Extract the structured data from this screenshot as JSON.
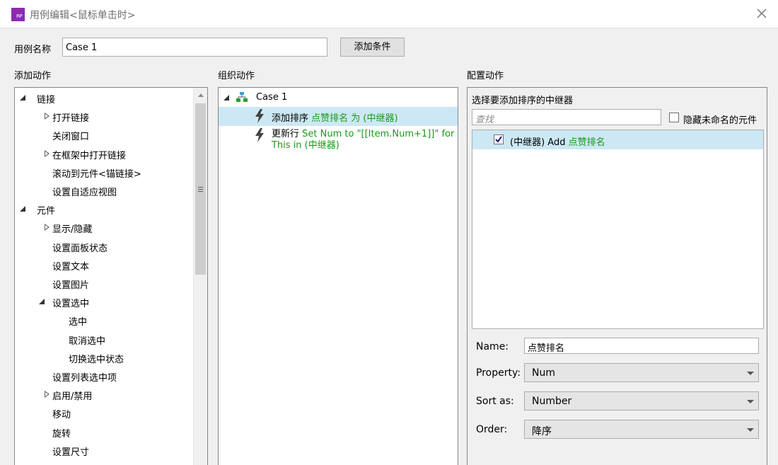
{
  "window": {
    "title": "用例编辑<鼠标单击时>",
    "icon_text": "RP",
    "accent": "#8b2bb0"
  },
  "case": {
    "name_label": "用例名称",
    "name_value": "Case 1",
    "add_condition_label": "添加条件"
  },
  "sections": {
    "add_actions": "添加动作",
    "organize_actions": "组织动作",
    "configure_actions": "配置动作"
  },
  "left_tree": [
    {
      "label": "链接",
      "level": 0,
      "toggle": "expanded"
    },
    {
      "label": "打开链接",
      "level": 1,
      "toggle": "collapsed"
    },
    {
      "label": "关闭窗口",
      "level": 1,
      "toggle": "none"
    },
    {
      "label": "在框架中打开链接",
      "level": 1,
      "toggle": "collapsed"
    },
    {
      "label": "滚动到元件<锚链接>",
      "level": 1,
      "toggle": "none"
    },
    {
      "label": "设置自适应视图",
      "level": 1,
      "toggle": "none"
    },
    {
      "label": "元件",
      "level": 0,
      "toggle": "expanded"
    },
    {
      "label": "显示/隐藏",
      "level": 1,
      "toggle": "collapsed"
    },
    {
      "label": "设置面板状态",
      "level": 1,
      "toggle": "none"
    },
    {
      "label": "设置文本",
      "level": 1,
      "toggle": "none"
    },
    {
      "label": "设置图片",
      "level": 1,
      "toggle": "none"
    },
    {
      "label": "设置选中",
      "level": 1,
      "toggle": "expanded"
    },
    {
      "label": "选中",
      "level": 2,
      "toggle": "none"
    },
    {
      "label": "取消选中",
      "level": 2,
      "toggle": "none"
    },
    {
      "label": "切换选中状态",
      "level": 2,
      "toggle": "none"
    },
    {
      "label": "设置列表选中项",
      "level": 1,
      "toggle": "none"
    },
    {
      "label": "启用/禁用",
      "level": 1,
      "toggle": "collapsed"
    },
    {
      "label": "移动",
      "level": 1,
      "toggle": "none"
    },
    {
      "label": "旋转",
      "level": 1,
      "toggle": "none"
    },
    {
      "label": "设置尺寸",
      "level": 1,
      "toggle": "none"
    }
  ],
  "mid_tree": {
    "case_label": "Case 1",
    "actions": [
      {
        "prefix": "添加排序 ",
        "green": "点赞排名 为 (中继器)",
        "selected": true
      },
      {
        "prefix": "更新行 ",
        "green": "Set Num to \"[[Item.Num+1]]\" for This in (中继器)",
        "selected": false
      }
    ]
  },
  "config": {
    "title": "选择要添加排序的中继器",
    "search_placeholder": "查找",
    "hide_unnamed_label": "隐藏未命名的元件",
    "hide_unnamed_checked": false,
    "repeater_row": {
      "prefix": "(中继器) Add ",
      "green": "点赞排名",
      "checked": true
    },
    "name_label": "Name:",
    "name_value": "点赞排名",
    "property_label": "Property:",
    "property_value": "Num",
    "sortas_label": "Sort as:",
    "sortas_value": "Number",
    "order_label": "Order:",
    "order_value": "降序"
  },
  "colors": {
    "selection": "#cce8f4",
    "green_text": "#1a9a1a"
  }
}
